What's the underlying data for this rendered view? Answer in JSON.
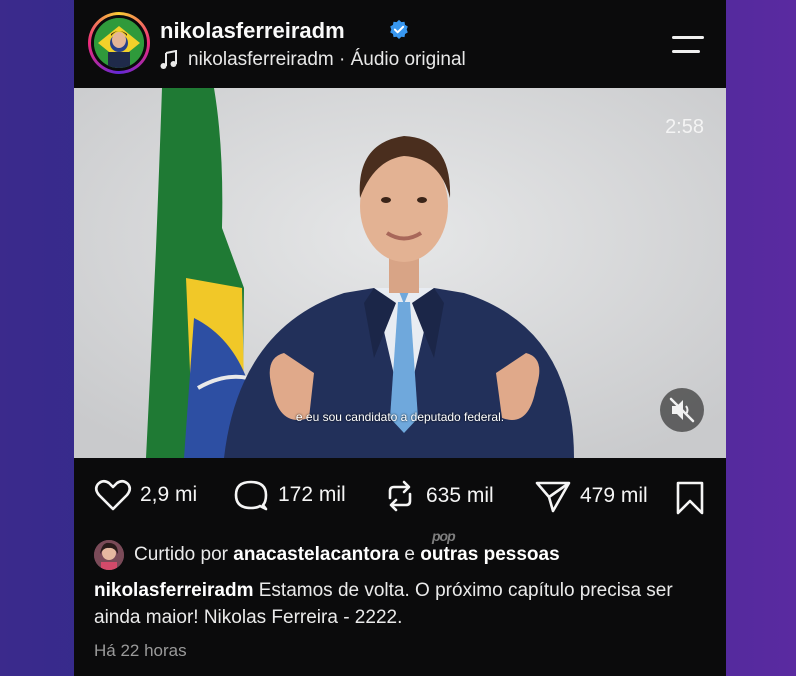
{
  "post": {
    "username": "nikolasferreiradm",
    "audio_text": "nikolasferreiradm · Áudio original",
    "video": {
      "duration": "2:58",
      "subtitle": "e eu sou candidato a deputado federal."
    },
    "stats": {
      "likes": "2,9 mi",
      "comments": "172 mil",
      "reposts": "635 mil",
      "shares": "479 mil"
    },
    "watermark": "pop",
    "liked_by": {
      "prefix": "Curtido por",
      "user": "anacastelacantora",
      "connector": "e",
      "others": "outras pessoas"
    },
    "caption": {
      "author": "nikolasferreiradm",
      "text": "Estamos de volta. O próximo capítulo precisa ser ainda maior! Nikolas Ferreira - 2222."
    },
    "timestamp": "Há 22 horas"
  },
  "colors": {
    "background": "#0b0b0c",
    "verified": "#3897f0",
    "text": "#f5f5f5",
    "muted": "#9a9a9a"
  }
}
